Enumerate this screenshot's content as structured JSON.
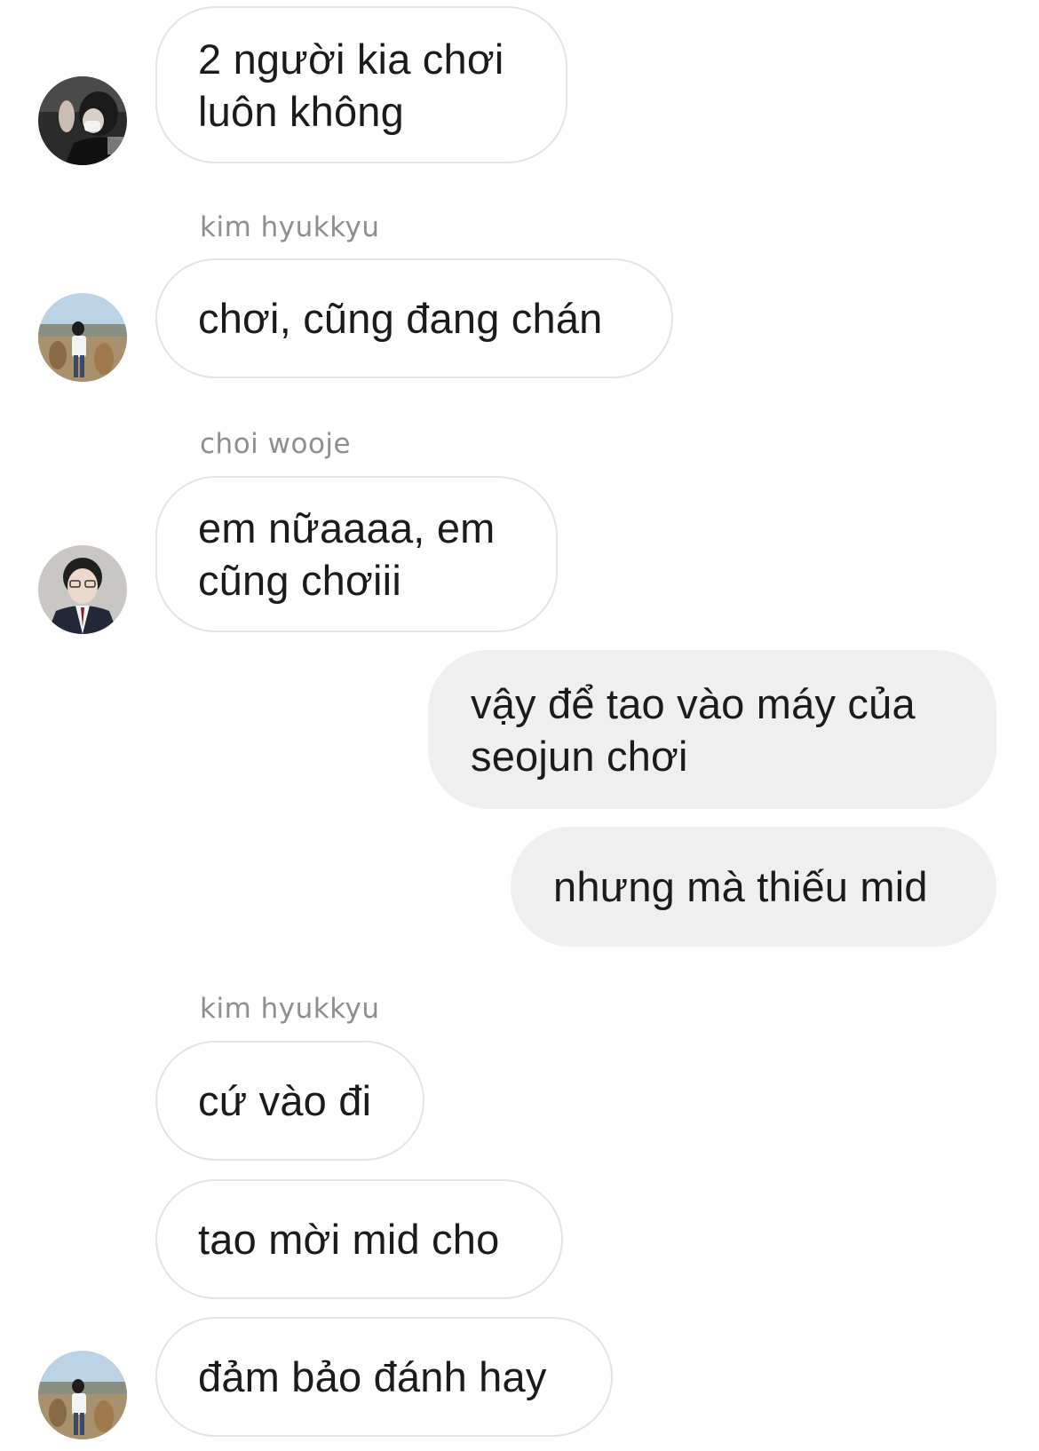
{
  "thread": {
    "messages": [
      {
        "from": "them",
        "lines": [
          "2 người kia chơi",
          "luôn không"
        ]
      },
      {
        "from": "them",
        "sender": "kim hyukkyu",
        "lines": [
          "chơi, cũng đang chán"
        ]
      },
      {
        "from": "them",
        "sender": "choi wooje",
        "lines": [
          "em nữaaaa, em",
          "cũng chơiii"
        ]
      },
      {
        "from": "me",
        "lines": [
          "vậy để tao vào máy của",
          "seojun chơi"
        ]
      },
      {
        "from": "me",
        "lines": [
          "nhưng mà thiếu mid"
        ]
      },
      {
        "from": "them",
        "sender": "kim hyukkyu",
        "lines": [
          "cứ vào đi"
        ]
      },
      {
        "from": "them",
        "lines": [
          "tao mời mid cho"
        ]
      },
      {
        "from": "them",
        "lines": [
          "đảm bảo đánh hay"
        ]
      }
    ]
  },
  "colors": {
    "incoming_bubble_border": "#e3e3e3",
    "outgoing_bubble_bg": "#efefef",
    "sender_name": "#8e8e8e",
    "text": "#1b1b1b"
  },
  "icons": [
    "avatar-photo-dark",
    "avatar-photo-outdoor",
    "avatar-photo-portrait"
  ]
}
